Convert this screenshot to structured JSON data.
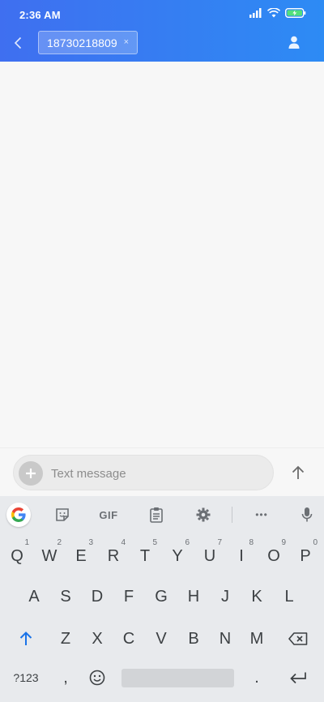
{
  "status_bar": {
    "time": "2:36 AM"
  },
  "header": {
    "recipient": "18730218809",
    "chip_remove": "×"
  },
  "composer": {
    "placeholder": "Text message"
  },
  "keyboard": {
    "toolbar": {
      "gif": "GIF",
      "more": "•••"
    },
    "row1": [
      {
        "key": "Q",
        "hint": "1"
      },
      {
        "key": "W",
        "hint": "2"
      },
      {
        "key": "E",
        "hint": "3"
      },
      {
        "key": "R",
        "hint": "4"
      },
      {
        "key": "T",
        "hint": "5"
      },
      {
        "key": "Y",
        "hint": "6"
      },
      {
        "key": "U",
        "hint": "7"
      },
      {
        "key": "I",
        "hint": "8"
      },
      {
        "key": "O",
        "hint": "9"
      },
      {
        "key": "P",
        "hint": "0"
      }
    ],
    "row2": [
      "A",
      "S",
      "D",
      "F",
      "G",
      "H",
      "J",
      "K",
      "L"
    ],
    "row3": [
      "Z",
      "X",
      "C",
      "V",
      "B",
      "N",
      "M"
    ],
    "row4": {
      "symbols": "?123",
      "comma": ",",
      "period": "."
    }
  },
  "colors": {
    "header_start": "#3f6ff0",
    "header_end": "#2d8bf4",
    "accent": "#1a73e8"
  }
}
